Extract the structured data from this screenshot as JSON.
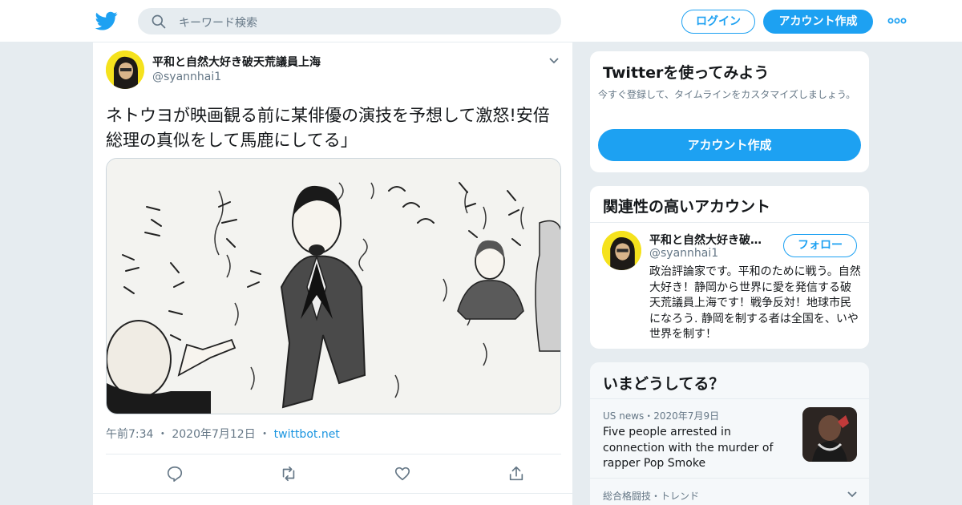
{
  "topbar": {
    "logo_icon": "twitter-bird-icon",
    "search_placeholder": "キーワード検索",
    "login_label": "ログイン",
    "signup_label": "アカウント作成",
    "more_icon": "more-dots-icon"
  },
  "tweet": {
    "display_name": "平和と自然大好き破天荒議員上海",
    "handle": "@syannhai1",
    "text": "ネトウヨが映画観る前に某俳優の演技を予想して激怒!安倍総理の真似をして馬鹿にしてる」",
    "time": "午前7:34",
    "date": "2020年7月12日",
    "source": "twittbot.net",
    "separator": "・",
    "actions": [
      "reply-icon",
      "retweet-icon",
      "like-icon",
      "share-icon"
    ]
  },
  "cards": {
    "try_twitter": {
      "title": "Twitterを使ってみよう",
      "subtitle": "今すぐ登録して、タイムラインをカスタマイズしましょう。",
      "cta": "アカウント作成"
    },
    "related": {
      "title": "関連性の高いアカウント",
      "name": "平和と自然大好き破…",
      "handle": "@syannhai1",
      "follow_label": "フォロー",
      "bio": "政治評論家です。平和のために戦う。自然大好き！静岡から世界に愛を発信する破天荒議員上海です！戦争反対！地球市民になろう. 静岡を制する者は全国を、いや世界を制す！"
    },
    "whats_happening": {
      "title": "いまどうしてる？",
      "meta": "US news・2020年7月9日",
      "headline": "Five people arrested in connection with the murder of rapper Pop Smoke",
      "trend_label": "総合格闘技・トレンド"
    }
  },
  "colors": {
    "accent": "#1da1f2",
    "background": "#e6ecf0",
    "secondary_text": "#657786"
  }
}
